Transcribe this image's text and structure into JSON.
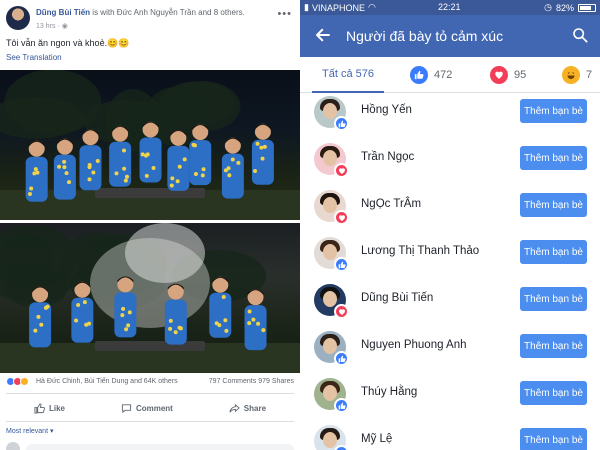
{
  "post": {
    "author": "Dũng Bùi Tiến",
    "with_text": " is with Đức Anh Nguyễn Trần and 8 others.",
    "time": "13 hrs ·",
    "text": "Tôi vẫn ăn ngon và khoẻ.😊😊",
    "see_translation": "See Translation",
    "reactors": "Hà Đức Chinh, Bùi Tiến Dung and 64K others",
    "comments_shares": "797 Comments  979 Shares",
    "actions": {
      "like": "Like",
      "comment": "Comment",
      "share": "Share"
    },
    "most_relevant": "Most relevant ▾",
    "photo1_people": 9,
    "photo2_people": 6
  },
  "status_bar": {
    "carrier": "VINAPHONE",
    "time": "22:21",
    "battery": "82%",
    "battery_fraction": 0.82
  },
  "header": {
    "title": "Người đã bày tỏ cảm xúc"
  },
  "tabs": {
    "all": "Tất cả 576",
    "like_count": "472",
    "love_count": "95",
    "haha_count": "7"
  },
  "add_friend_label": "Thêm bạn bè",
  "people": [
    {
      "name": "Hồng Yến",
      "reaction": "like",
      "bg": "#b9c8c9",
      "hair": "#2b1f1a"
    },
    {
      "name": "Trần Ngọc",
      "reaction": "love",
      "bg": "#f3c9cf",
      "hair": "#2a1b12"
    },
    {
      "name": "NgỌc TrÂm",
      "reaction": "love",
      "bg": "#e8d8cf",
      "hair": "#1e1510"
    },
    {
      "name": "Lương Thị Thanh Thảo",
      "reaction": "like",
      "bg": "#e3dbd5",
      "hair": "#3a2517"
    },
    {
      "name": "Dũng Bùi Tiến",
      "reaction": "love",
      "bg": "#233a63",
      "hair": "#111111"
    },
    {
      "name": "Nguyen Phuong Anh",
      "reaction": "like",
      "bg": "#9bb0c1",
      "hair": "#2c2018"
    },
    {
      "name": "Thúy Hằng",
      "reaction": "like",
      "bg": "#9fb38f",
      "hair": "#3b2618"
    },
    {
      "name": "Mỹ Lệ",
      "reaction": "like",
      "bg": "#d9e3ec",
      "hair": "#251a14"
    }
  ],
  "icons": {
    "back": "arrow-left-icon",
    "search": "search-icon",
    "like": "thumbs-up-icon",
    "love": "heart-icon",
    "haha": "laugh-emoji-icon"
  },
  "colors": {
    "brand": "#4267b2",
    "status_bar": "#3b5998",
    "button": "#4b8ef0",
    "like": "#3b7cff",
    "love": "#f33e58",
    "haha": "#f7b125"
  }
}
